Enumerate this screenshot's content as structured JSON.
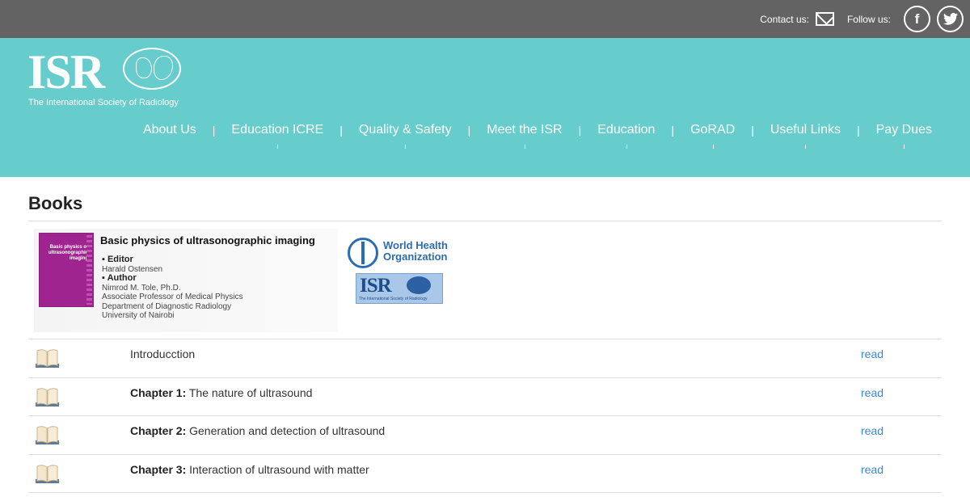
{
  "topbar": {
    "contact_label": "Contact us:",
    "contact_icon": "mail-icon",
    "follow_label": "Follow us:",
    "social": [
      {
        "name": "facebook",
        "glyph": "f"
      },
      {
        "name": "twitter",
        "glyph": "t"
      }
    ]
  },
  "header": {
    "logo_text": "ISR",
    "logo_subtitle": "The International Society of Radiology",
    "nav": [
      "About Us",
      "Education ICRE",
      "Quality & Safety",
      "Meet the ISR",
      "Education",
      "GoRAD",
      "Useful Links",
      "Pay Dues"
    ],
    "nav_separator": "|"
  },
  "page": {
    "title": "Books",
    "book": {
      "title": "Basic physics of ultrasonographic imaging",
      "cover_text": "Basic physics of ultrasonographic imaging",
      "editor_label": "Editor",
      "editor": "Harald Ostensen",
      "author_label": "Author",
      "author_lines": [
        "Nimrod M. Tole, Ph.D.",
        "Associate Professor of Medical Physics",
        "Department of Diagnostic Radiology",
        "University of Nairobi"
      ],
      "partner_who": "World Health Organization",
      "partner_who_lines": [
        "World Health",
        "Organization"
      ],
      "partner_isr": "ISR",
      "partner_isr_sub": "The International Society of Radiology"
    },
    "chapters": [
      {
        "prefix": "",
        "title": "Introducction",
        "link": "read"
      },
      {
        "prefix": "Chapter 1:",
        "title": " The nature of ultrasound",
        "link": "read"
      },
      {
        "prefix": "Chapter 2:",
        "title": " Generation and detection of ultrasound",
        "link": "read"
      },
      {
        "prefix": "Chapter 3:",
        "title": " Interaction of ultrasound with matter",
        "link": "read"
      }
    ]
  },
  "colors": {
    "topbar": "#636363",
    "header": "#66cccc",
    "link": "#3a87d6"
  }
}
